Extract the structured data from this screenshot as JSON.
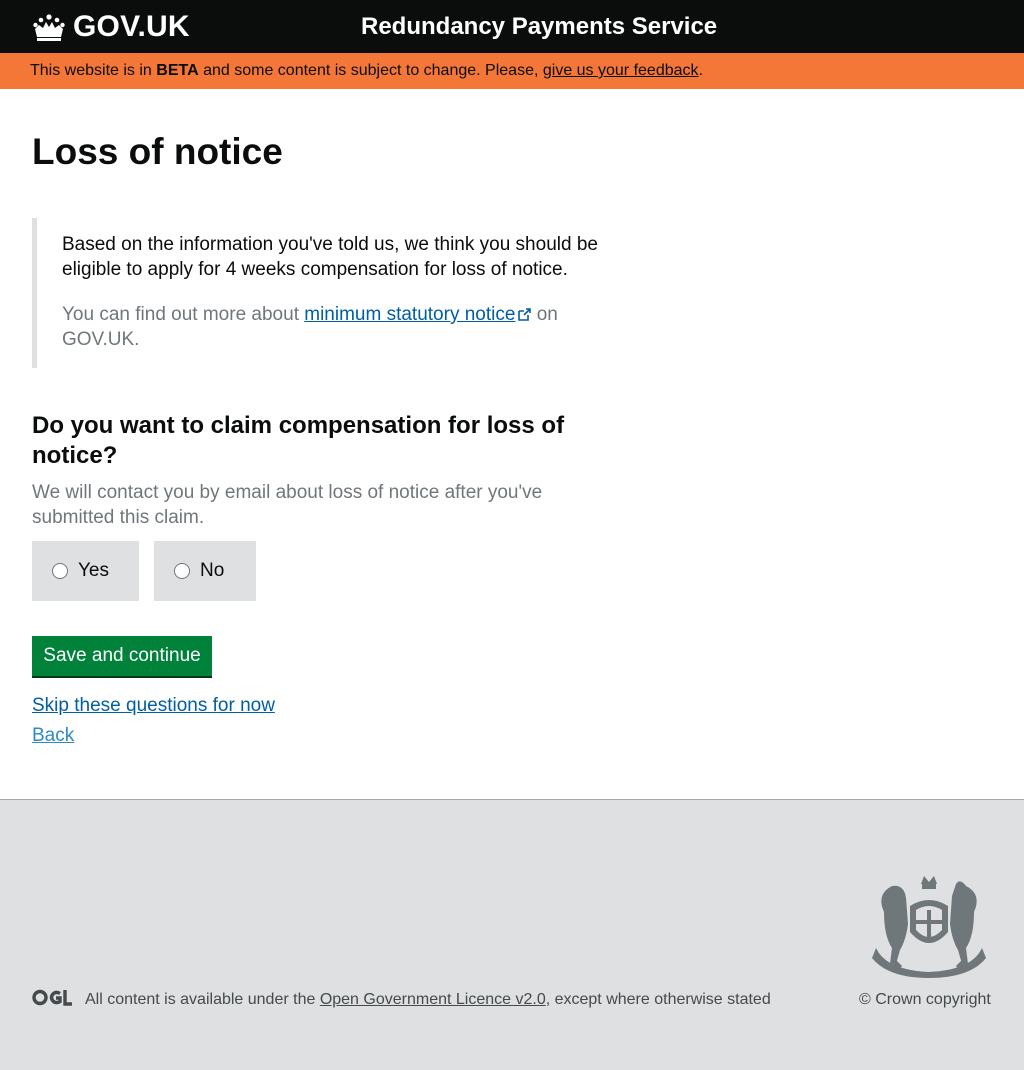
{
  "header": {
    "logo_text": "GOV.UK",
    "service_name": "Redundancy Payments Service"
  },
  "beta_banner": {
    "prefix": "This website is in ",
    "tag": "BETA",
    "middle": " and some content is subject to change. Please, ",
    "link": "give us your feedback",
    "suffix": "."
  },
  "main": {
    "title": "Loss of notice",
    "inset": {
      "message": "Based on the information you've told us, we think you should be eligible to apply for 4 weeks compensation for loss of notice.",
      "more_prefix": "You can find out more about ",
      "more_link": "minimum statutory notice",
      "more_suffix": " on GOV.UK."
    },
    "question": "Do you want to claim compensation for loss of notice?",
    "hint": "We will contact you by email about loss of notice after you've submitted this claim.",
    "options": [
      {
        "label": "Yes"
      },
      {
        "label": "No"
      }
    ],
    "save_button": "Save and continue",
    "skip_link": "Skip these questions for now",
    "back_link": "Back"
  },
  "footer": {
    "licence_prefix": "All content is available under the ",
    "licence_link": "Open Government Licence v2.0",
    "licence_suffix": ", except where otherwise stated",
    "copyright": "© Crown copyright"
  },
  "colors": {
    "header_bg": "#0b0c0c",
    "beta_bg": "#f47738",
    "button_green": "#00823b",
    "link_blue": "#005ea5",
    "footer_bg": "#dee0e2"
  },
  "icons": [
    "crown-icon",
    "external-link-icon",
    "royal-crest-icon",
    "ogl-logo-icon"
  ]
}
